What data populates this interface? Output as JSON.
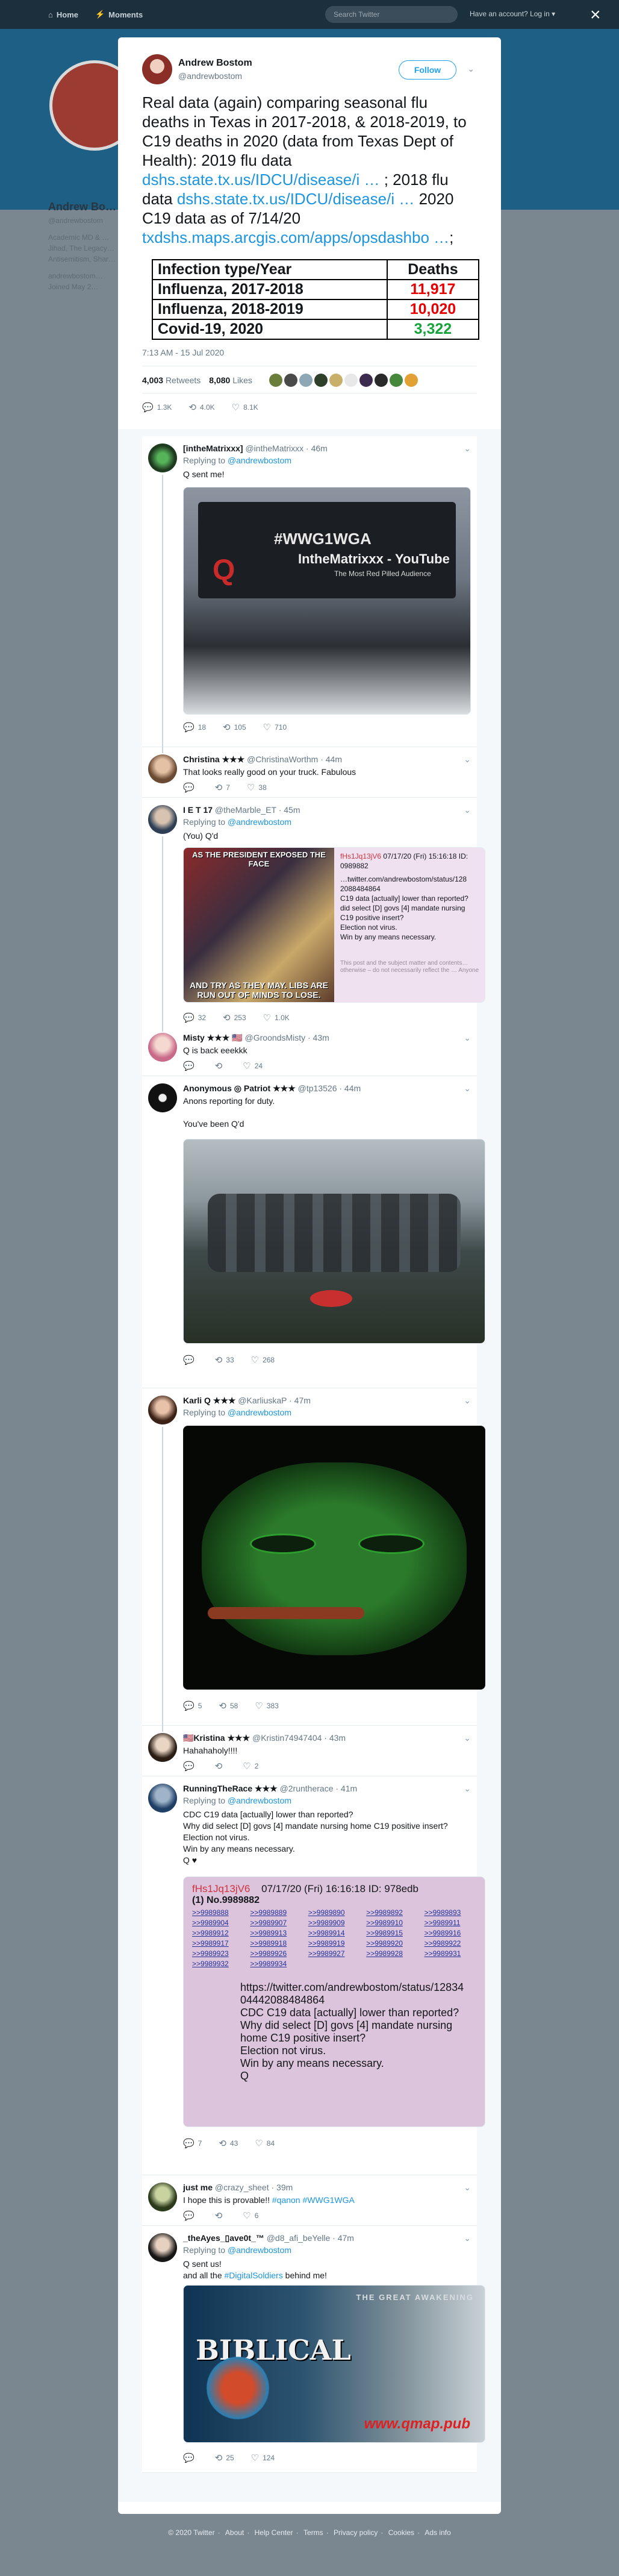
{
  "topnav": {
    "home_label": "Home",
    "moments_label": "Moments",
    "search_placeholder": "Search Twitter",
    "login_label": "Have an account? Log in ▾"
  },
  "background_profile": {
    "name": "Andrew Bo…",
    "handle": "@andrewbostom",
    "bio": "Academic MD & …Jihad, The Legacy… Antisemitism, Shar…",
    "link": "andrewbostom…",
    "joined": "Joined May 2…"
  },
  "main_tweet": {
    "name": "Andrew Bostom",
    "handle": "@andrewbostom",
    "follow_label": "Follow",
    "text_1": "Real data (again) comparing seasonal flu deaths in Texas in 2017-2018, & 2018-2019, to C19 deaths in 2020 (data from Texas Dept of Health): 2019 flu data",
    "link_1": "dshs.state.tx.us/IDCU/disease/i …",
    "text_2": "; 2018 flu data",
    "link_2": "dshs.state.tx.us/IDCU/disease/i …",
    "text_3": "2020 C19 data as of 7/14/20",
    "link_3": "txdshs.maps.arcgis.com/apps/opsdashbo …",
    "text_4": ";",
    "table": {
      "header_type": "Infection type/Year",
      "header_deaths": "Deaths",
      "rows": [
        {
          "type": "Influenza, 2017-2018",
          "deaths": "11,917"
        },
        {
          "type": "Influenza, 2018-2019",
          "deaths": "10,020"
        },
        {
          "type": "Covid-19, 2020",
          "deaths": "3,322"
        }
      ]
    },
    "timestamp": "7:13 AM - 15 Jul 2020",
    "retweets_count": "4,003",
    "retweets_label": "Retweets",
    "likes_count": "8,080",
    "likes_label": "Likes",
    "reply_count": "1.3K",
    "retweet_count": "4.0K",
    "like_count": "8.1K"
  },
  "replies": [
    {
      "name": "[intheMatrixxx]",
      "handle": "@intheMatrixxx · 46m",
      "replying": "Replying to",
      "replying_to": "@andrewbostom",
      "text": "Q sent me!",
      "media_title": "#WWG1WGA",
      "media_sub": "IntheMatrixxx - YouTube",
      "media_sub2": "The Most Red Pilled Audience",
      "reply_count": "18",
      "retweet_count": "105",
      "like_count": "710"
    },
    {
      "name": "Christina ★★★",
      "handle": "@ChristinaWorthm · 44m",
      "text": "That looks really good on your truck. Fabulous",
      "reply_count": "",
      "retweet_count": "7",
      "like_count": "38"
    },
    {
      "name": "I E T 17",
      "handle": "@theMarble_ET · 45m",
      "replying": "Replying to",
      "replying_to": "@andrewbostom",
      "text": "(You) Q'd",
      "media_top": "AS THE PRESIDENT EXPOSED THE FACE",
      "media_bottom": "AND TRY AS THEY MAY. LIBS ARE RUN OUT OF MINDS TO LOSE.",
      "post_id": "fHs1Jq13jV6",
      "post_date": "07/17/20 (Fri) 15:16:18 ID: 0989882",
      "post_lines": [
        "…twitter.com/andrewbostom/status/128",
        "2088484864",
        "C19 data [actually] lower than reported?",
        "did select [D] govs [4] mandate nursing",
        "C19 positive insert?",
        "Election not virus.",
        "Win by any means necessary."
      ],
      "post_note": "This post and the subject matter and contents… otherwise – do not necessarily reflect the … Anyone",
      "reply_count": "32",
      "retweet_count": "253",
      "like_count": "1.0K"
    },
    {
      "name": "Misty ★★★ 🇺🇸",
      "handle": "@GroondsMisty · 43m",
      "text": "Q is back eeekkk",
      "reply_count": "",
      "retweet_count": "",
      "like_count": "24"
    },
    {
      "name": "Anonymous ◎ Patriot ★★★",
      "handle": "@tp13526 · 44m",
      "text": "Anons reporting for duty.",
      "text_2": "You've been Q'd",
      "reply_count": "",
      "retweet_count": "33",
      "like_count": "268"
    },
    {
      "name": "Karli Q ★★★",
      "handle": "@KarliuskaP · 47m",
      "replying": "Replying to",
      "replying_to": "@andrewbostom",
      "reply_count": "5",
      "retweet_count": "58",
      "like_count": "383"
    },
    {
      "name": "🇺🇸Kristina ★★★",
      "handle": "@Kristin74947404 · 43m",
      "text": "Hahahaholy!!!!",
      "reply_count": "",
      "retweet_count": "",
      "like_count": "2"
    },
    {
      "name": "RunningTheRace ★★★",
      "handle": "@2runtherace · 41m",
      "replying": "Replying to",
      "replying_to": "@andrewbostom",
      "lines": [
        "CDC C19 data [actually] lower than reported?",
        "Why did select [D] govs [4] mandate nursing home C19 positive insert?",
        "Election not virus.",
        "Win by any means necessary.",
        "Q ♥"
      ],
      "post_id": "fHs1Jq13jV6",
      "post_header": "07/17/20 (Fri) 16:16:18 ID: 978edb",
      "post_no": "(1) No.9989882",
      "post_refs": [
        ">>9989888",
        ">>9989889",
        ">>9989890",
        ">>9989892",
        ">>9989893",
        ">>9989904",
        ">>9989907",
        ">>9989909",
        ">>9989910",
        ">>9989911",
        ">>9989912",
        ">>9989913",
        ">>9989914",
        ">>9989915",
        ">>9989916",
        ">>9989917",
        ">>9989918",
        ">>9989919",
        ">>9989920",
        ">>9989922",
        ">>9989923",
        ">>9989926",
        ">>9989927",
        ">>9989928",
        ">>9989931",
        ">>9989932",
        ">>9989934"
      ],
      "post_body": [
        "https://twitter.com/andrewbostom/status/12834",
        "04442088484864",
        "CDC C19 data [actually] lower than reported?",
        "Why did select [D] govs [4] mandate nursing",
        "home C19 positive insert?",
        "Election not virus.",
        "Win by any means necessary.",
        "Q"
      ],
      "reply_count": "7",
      "retweet_count": "43",
      "like_count": "84"
    },
    {
      "name": "just me",
      "handle": "@crazy_sheet · 39m",
      "text_pre": "I hope this is provable!!",
      "hashtags": "#qanon #WWG1WGA",
      "reply_count": "",
      "retweet_count": "",
      "like_count": "6"
    },
    {
      "name": "_theAyes_▯ave0t_™",
      "handle": "@d8_afi_beYelle · 47m",
      "replying": "Replying to",
      "replying_to": "@andrewbostom",
      "text": "Q sent us!",
      "text_2_pre": "and all the",
      "text_2_hash": "#DigitalSoldiers",
      "text_2_post": "behind me!",
      "media_title": "BIBLICAL",
      "media_sub": "THE GREAT AWAKENING",
      "media_url": "www.qmap.pub",
      "reply_count": "",
      "retweet_count": "25",
      "like_count": "124"
    }
  ],
  "footer": {
    "items": [
      "© 2020 Twitter",
      "About",
      "Help Center",
      "Terms",
      "Privacy policy",
      "Cookies",
      "Ads info"
    ]
  },
  "icons": {
    "reply": "reply-icon",
    "retweet": "retweet-icon",
    "like": "heart-icon",
    "close": "close-icon",
    "caret": "chevron-down-icon"
  },
  "colors": {
    "accent": "#1da1f2",
    "red_value": "#e60000",
    "green_value": "#16a43a"
  }
}
